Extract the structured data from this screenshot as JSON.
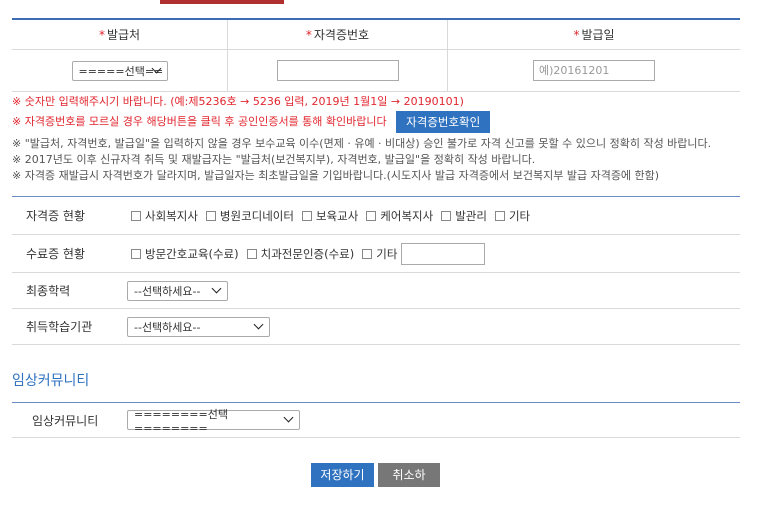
{
  "cert": {
    "headers": {
      "issuer": "발급처",
      "number": "자격증번호",
      "date": "발급일"
    },
    "required_mark": "*",
    "issuer_select": "=====선택==",
    "number_value": "",
    "date_placeholder": "예)20161201"
  },
  "notes": {
    "line1": "※ 숫자만 입력해주시기 바랍니다. (예:제5236호 → 5236 입력, 2019년 1월1일 → 20190101)",
    "line2": "※ 자격증번호를 모르실 경우 해당버튼을 클릭 후 공인인증서를 통해 확인바랍니다",
    "verify_button": "자격증번호확인",
    "line3": "※ \"발급처, 자격번호, 발급일\"을 입력하지 않을 경우 보수교육 이수(면제 · 유예 · 비대상) 승인 불가로 자격 신고를 못할 수 있으니 정확히 작성 바랍니다.",
    "line4": "※ 2017년도 이후 신규자격 취득 및 재발급자는 \"발급처(보건복지부), 자격번호, 발급일\"을 정확히 작성 바랍니다.",
    "line5": "※ 자격증 재발급시 자격번호가 달라지며, 발급일자는 최초발급일을 기입바랍니다.(시도지사 발급 자격증에서 보건복지부 발급 자격증에 한함)"
  },
  "info": {
    "qual_label": "자격증 현황",
    "qual_options": [
      "사회복지사",
      "병원코디네이터",
      "보육교사",
      "케어복지사",
      "발관리",
      "기타"
    ],
    "completion_label": "수료증 현황",
    "completion_options": [
      "방문간호교육(수료)",
      "치과전문인증(수료)",
      "기타"
    ],
    "completion_other_value": "",
    "education_label": "최종학력",
    "education_select": "--선택하세요--",
    "institution_label": "취득학습기관",
    "institution_select": "--선택하세요--"
  },
  "community": {
    "section_title": "임상커뮤니티",
    "label": "임상커뮤니티",
    "select": "========선택========"
  },
  "actions": {
    "save": "저장하기",
    "cancel": "취소하기"
  },
  "colors": {
    "accent": "#2f72c0",
    "required": "#e0262e",
    "cancel": "#777777"
  }
}
